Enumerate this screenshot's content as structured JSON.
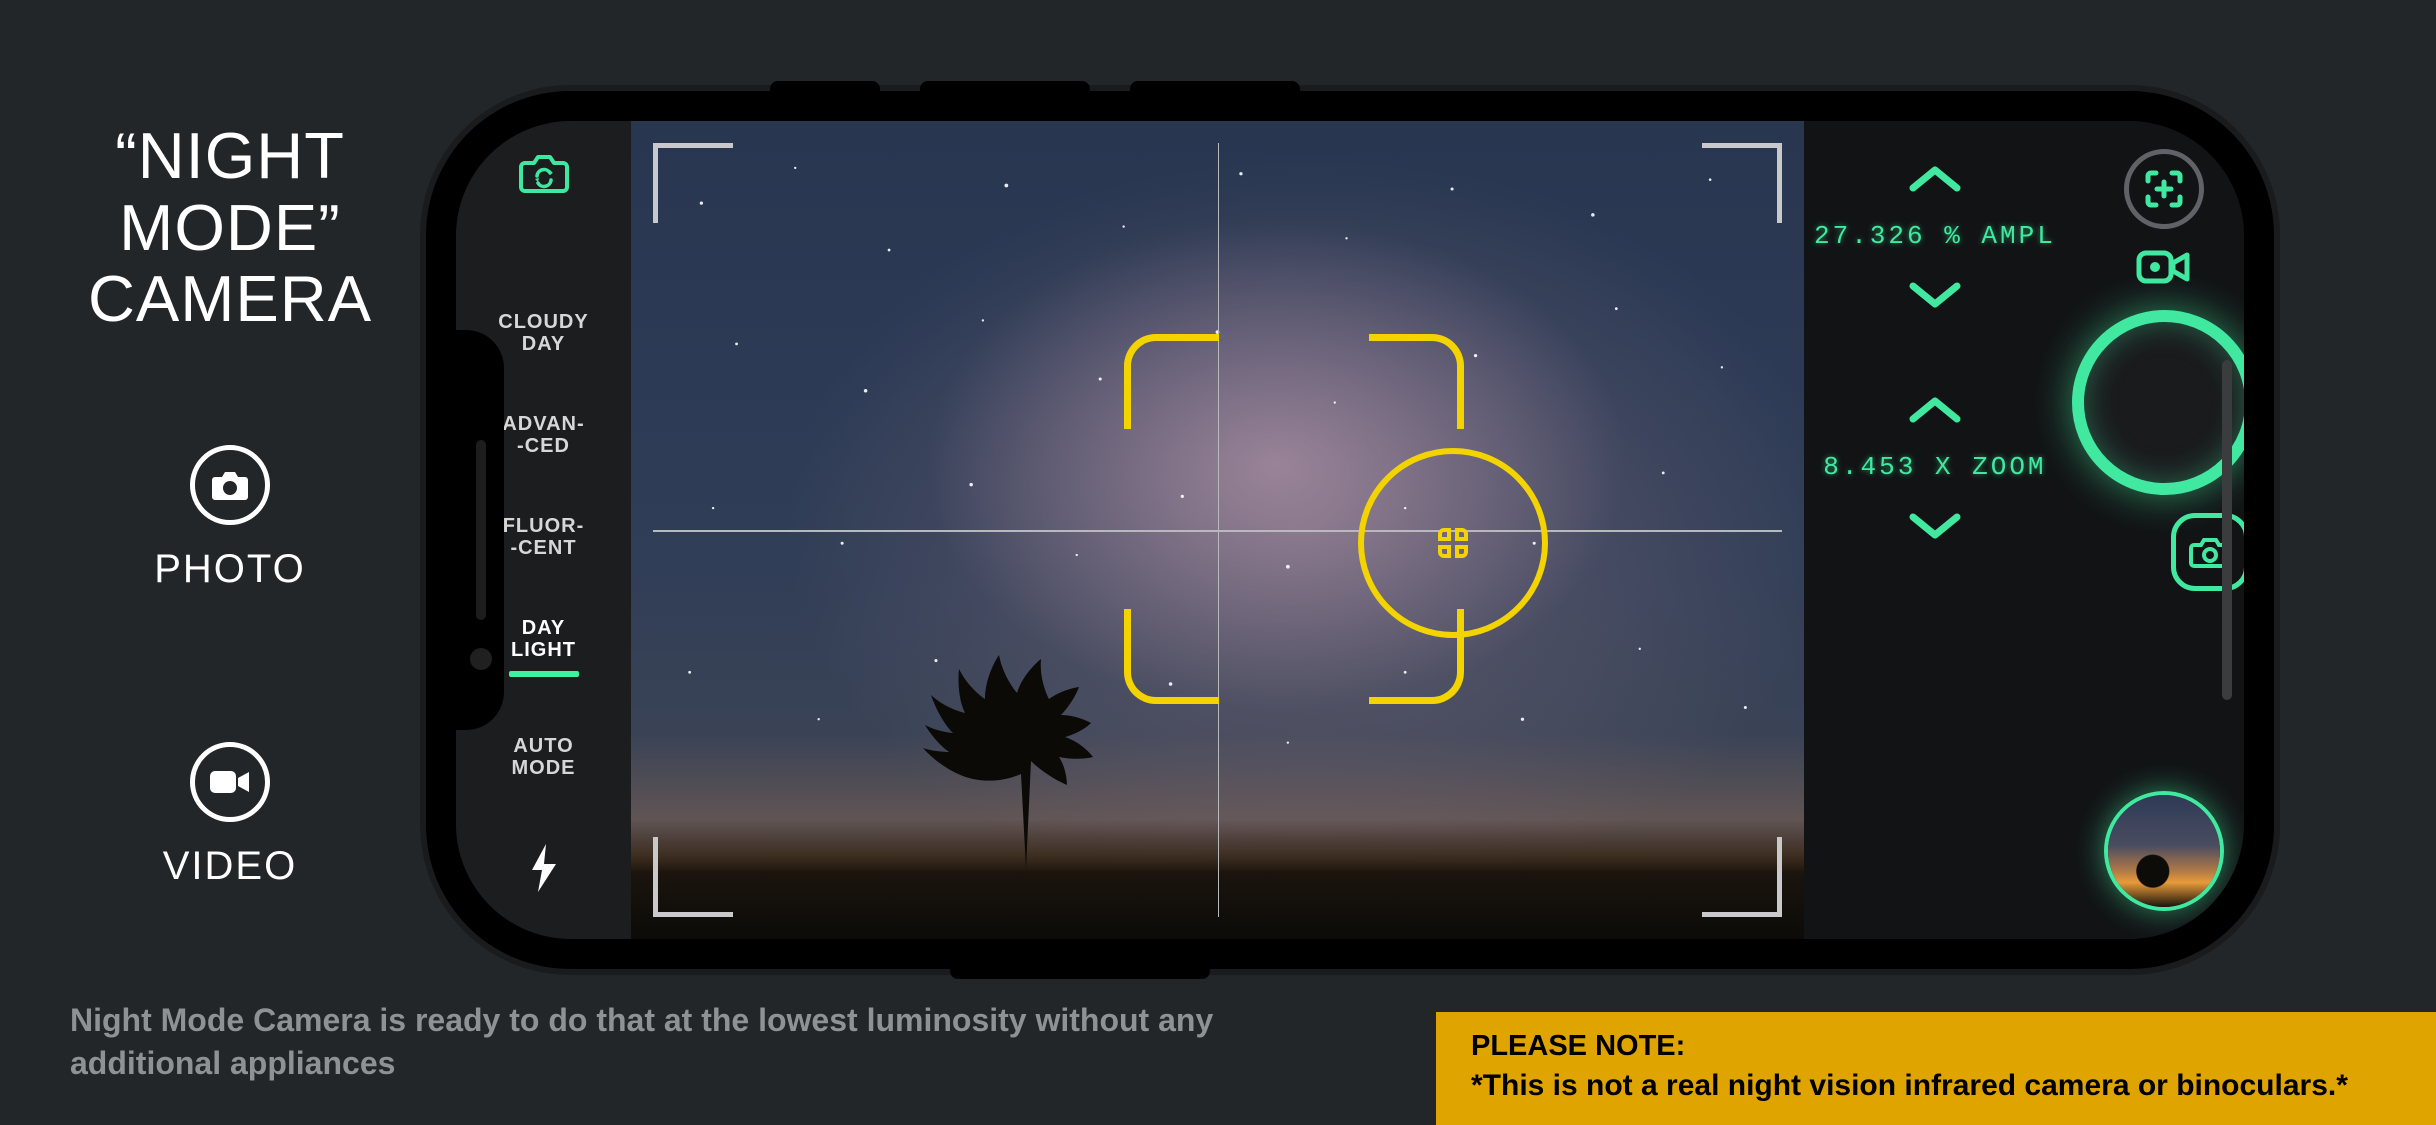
{
  "promo": {
    "title_line1": "“NIGHT",
    "title_line2": "MODE”",
    "title_line3": "CAMERA",
    "photo_label": "PHOTO",
    "video_label": "VIDEO"
  },
  "footer": {
    "caption": "Night Mode Camera is ready to do that at the lowest luminosity without any additional appliances",
    "note_heading": "PLEASE NOTE:",
    "note_body": "*This is not a real night vision infrared camera or binoculars.*"
  },
  "app": {
    "icons": {
      "camera_switch": "camera-switch-icon",
      "flash": "flash-icon",
      "focus_plus": "focus-plus-icon",
      "video": "video-icon",
      "photo_small": "camera-icon",
      "chevron_up": "chevron-up-icon",
      "chevron_down": "chevron-down-icon"
    },
    "modes": [
      {
        "line1": "CLOUDY",
        "line2": "DAY",
        "active": false
      },
      {
        "line1": "ADVAN-",
        "line2": "-CED",
        "active": false
      },
      {
        "line1": "FLUOR-",
        "line2": "-CENT",
        "active": false
      },
      {
        "line1": "DAY",
        "line2": "LIGHT",
        "active": true
      },
      {
        "line1": "AUTO",
        "line2": "MODE",
        "active": false
      }
    ],
    "readouts": {
      "ampl": "27.326 % AMPL",
      "zoom": "8.453 X ZOOM"
    },
    "colors": {
      "accent": "#41e9a0",
      "focus": "#f3d400",
      "note_bg": "#e0a400"
    }
  }
}
